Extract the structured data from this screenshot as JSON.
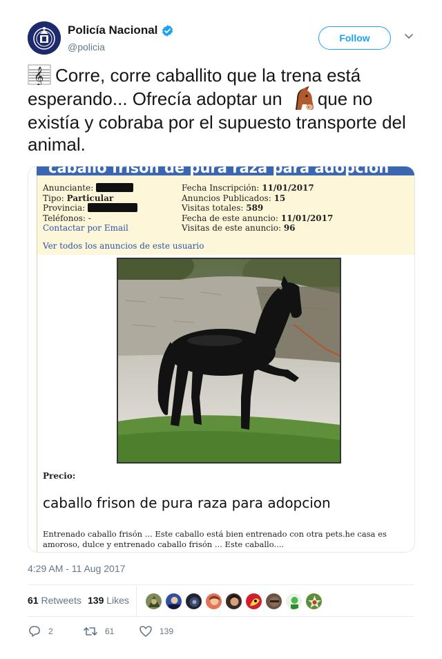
{
  "author": {
    "display_name": "Policía Nacional",
    "handle": "@policia",
    "verified": true,
    "avatar_icon": "police-badge-icon"
  },
  "follow_label": "Follow",
  "tweet": {
    "text_part1": "Corre, corre caballito que la trena está esperando... Ofrecía adoptar un",
    "text_part2": "que no existía y cobraba por el supuesto transporte del animal.",
    "emoji_1": "musical-score-emoji",
    "emoji_2": "horse-face-emoji"
  },
  "media": {
    "header_title": "caballo frison de pura raza para adopcion",
    "info_left": {
      "anunciante_label": "Anunciante:",
      "tipo_label": "Tipo:",
      "tipo_value": "Particular",
      "provincia_label": "Provincia:",
      "telefonos_label": "Teléfonos:",
      "telefonos_value": "-",
      "contact_link": "Contactar por Email"
    },
    "info_right": {
      "fecha_inscripcion_label": "Fecha Inscripción:",
      "fecha_inscripcion_value": "11/01/2017",
      "anuncios_label": "Anuncios Publicados:",
      "anuncios_value": "15",
      "visitas_totales_label": "Visitas totales:",
      "visitas_totales_value": "589",
      "fecha_anuncio_label": "Fecha de este anuncio:",
      "fecha_anuncio_value": "11/01/2017",
      "visitas_anuncio_label": "Visitas de este anuncio:",
      "visitas_anuncio_value": "96"
    },
    "see_all_link": "Ver todos los anuncios de este usuario",
    "precio_label": "Precio:",
    "ad_title": "caballo frison de pura raza para adopcion",
    "ad_description": "Entrenado caballo frisón ... Este caballo está bien entrenado con otra pets.he casa es amoroso, dulce y entrenado caballo frisón ... Este caballo...."
  },
  "timestamp": "4:29 AM - 11 Aug 2017",
  "stats": {
    "retweets_count": "61",
    "retweets_label": "Retweets",
    "likes_count": "139",
    "likes_label": "Likes"
  },
  "actions": {
    "reply_count": "2",
    "retweet_count": "61",
    "like_count": "139"
  },
  "colors": {
    "twitter_blue": "#1da1f2",
    "text_primary": "#14171a",
    "text_secondary": "#657786",
    "ad_header_blue": "#3b67b0",
    "ad_info_bg": "#fdf6d9"
  }
}
